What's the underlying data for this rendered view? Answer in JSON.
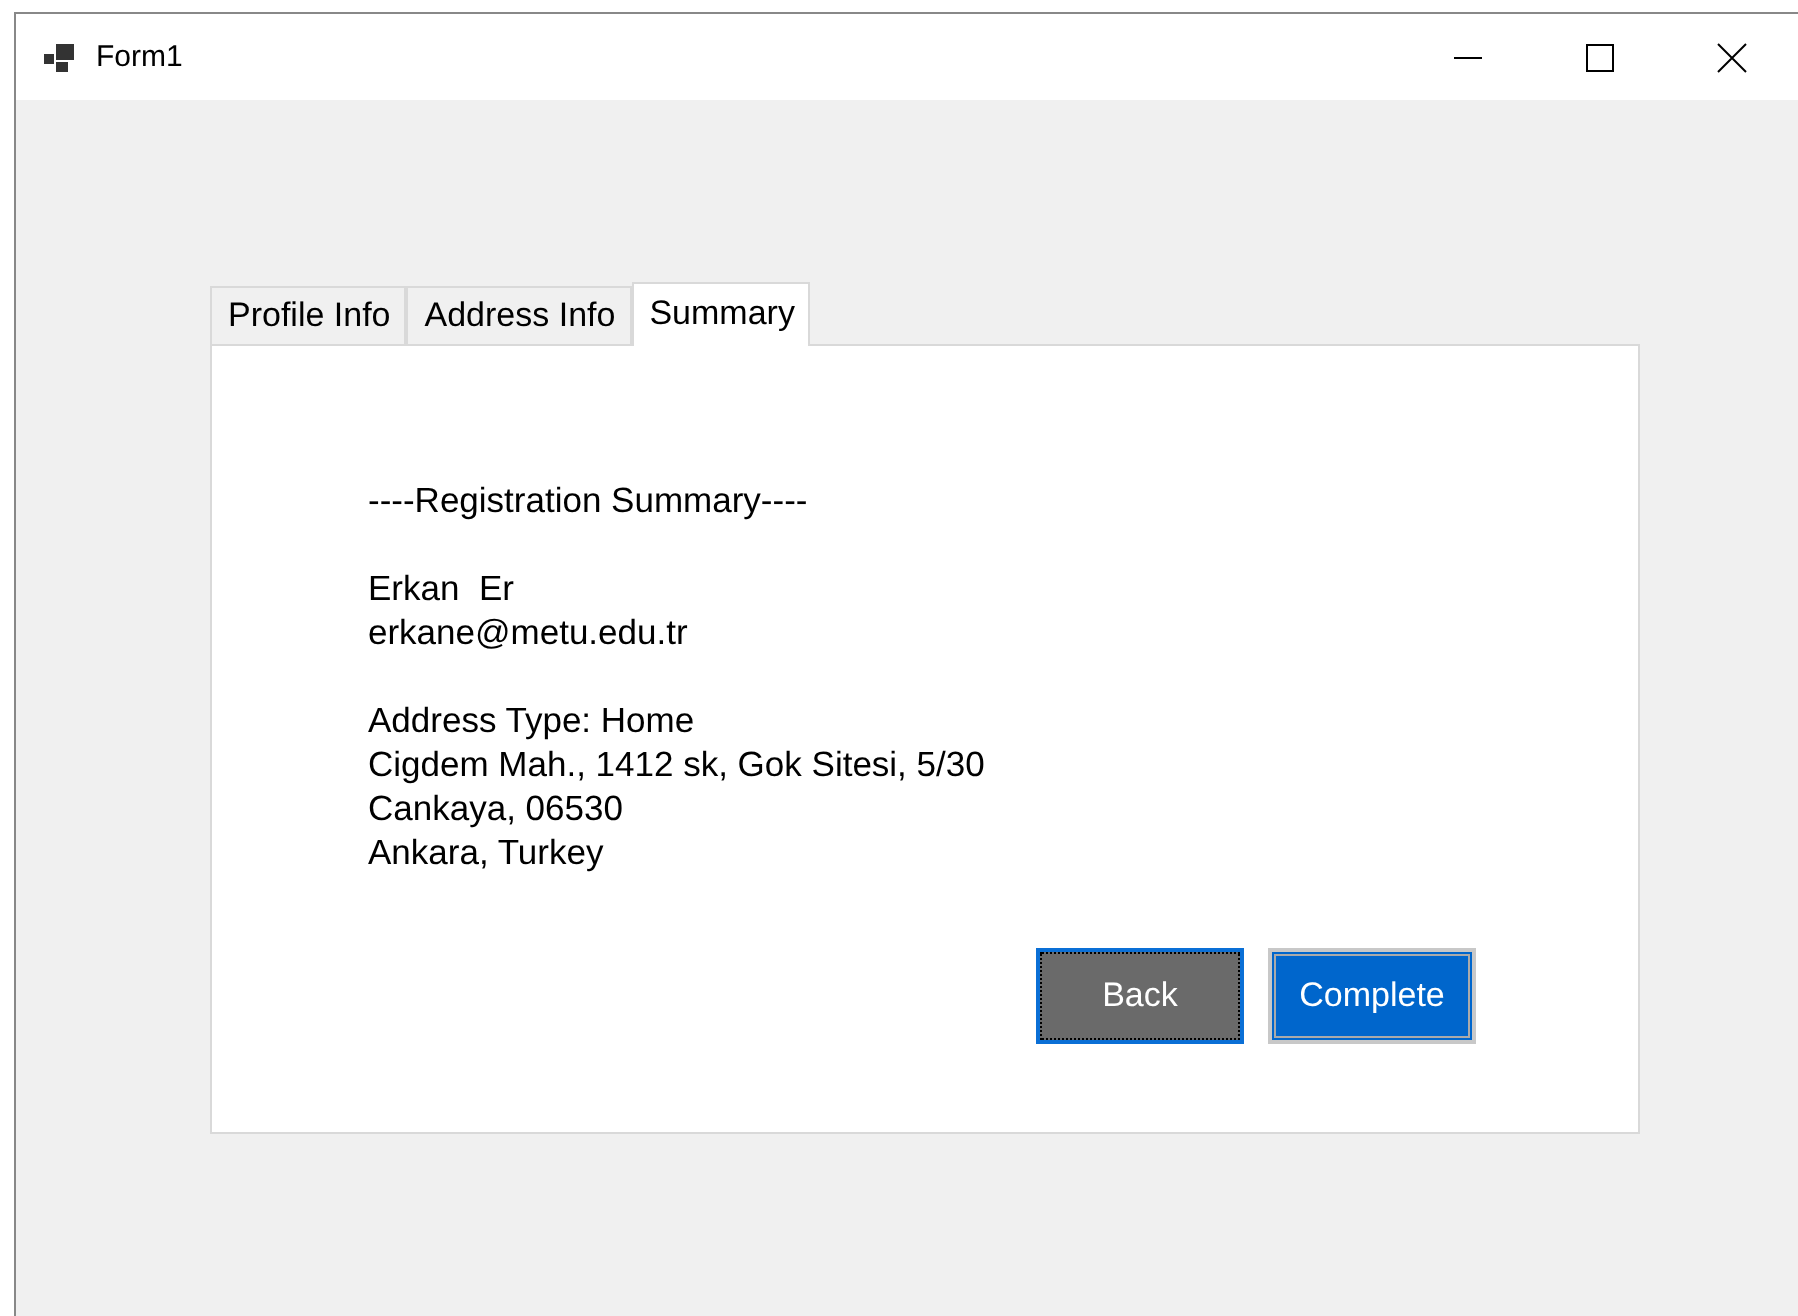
{
  "window": {
    "title": "Form1"
  },
  "tabs": [
    {
      "label": "Profile Info",
      "selected": false
    },
    {
      "label": "Address Info",
      "selected": false
    },
    {
      "label": "Summary",
      "selected": true
    }
  ],
  "summary": {
    "groups": [
      [
        "----Registration Summary----"
      ],
      [
        "Erkan  Er",
        "erkane@metu.edu.tr"
      ],
      [
        "Address Type: Home",
        "Cigdem Mah., 1412 sk, Gok Sitesi, 5/30",
        "Cankaya, 06530",
        "Ankara, Turkey"
      ]
    ]
  },
  "buttons": [
    {
      "label": "Back",
      "kind": "secondary",
      "focused": true
    },
    {
      "label": "Complete",
      "kind": "primary",
      "focused": false
    }
  ]
}
